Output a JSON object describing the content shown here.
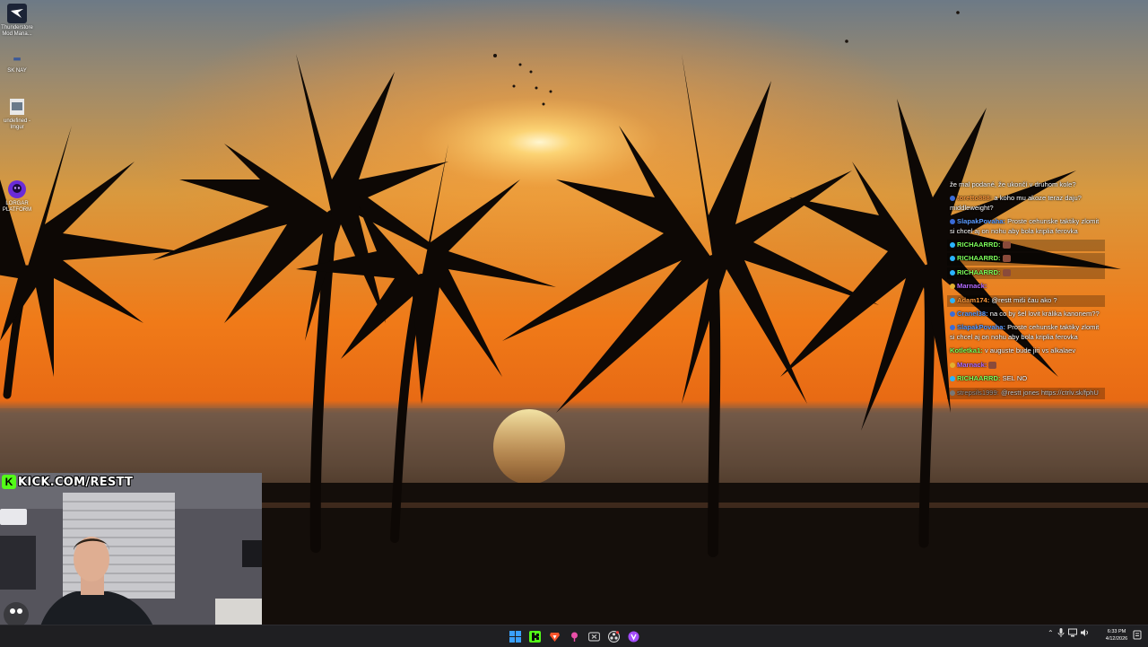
{
  "desktop": {
    "icons": [
      {
        "label": "Thunderstore Mod Mana...",
        "icon": "thunderstore-icon"
      },
      {
        "label": "SK NAY",
        "icon": "shortcut-icon"
      },
      {
        "label": "undefined - Imgur",
        "icon": "image-file-icon"
      },
      {
        "label": "LORGAR PLATFORM",
        "icon": "lorgar-icon"
      }
    ]
  },
  "chat": {
    "messages": [
      {
        "user": "",
        "text": "že mal podané, že ukončí v druhom kole?",
        "user_color": "#ffffff"
      },
      {
        "user": "toretto888:",
        "text": "a koho mu akoze teraz daju? middleweight?",
        "user_color": "#ff9a3c"
      },
      {
        "user": "SlapakPovaha:",
        "text": "Proste cehunske taktiky zlomit si chcel aj on nohu aby bola kriplia ferovka",
        "user_color": "#5b9bff"
      },
      {
        "user": "RICHAARRD:",
        "text": "",
        "user_color": "#7dff5a",
        "emote": true
      },
      {
        "user": "RICHAARRD:",
        "text": "",
        "user_color": "#7dff5a",
        "emote": true
      },
      {
        "user": "RICHAARRD:",
        "text": "",
        "user_color": "#7dff5a",
        "emote": true
      },
      {
        "user": "Marnack:",
        "text": "",
        "user_color": "#b46bff"
      },
      {
        "user": "Adam174:",
        "text": "@restt miši čau ako ?",
        "user_color": "#ff9a3c"
      },
      {
        "user": "Cranel38:",
        "text": "na co by šel lovit králika kanonem??",
        "user_color": "#5b9bff"
      },
      {
        "user": "SlapakPovaha:",
        "text": "Proste cehunske taktiky zlomit si chcel aj on nohu aby bola kriplia ferovka",
        "user_color": "#5b9bff"
      },
      {
        "user": "Kotletka1:",
        "text": "v auguste bude jiri vs alkalaev",
        "user_color": "#7dff5a"
      },
      {
        "user": "Marnack:",
        "text": "",
        "user_color": "#b46bff",
        "emote": true
      },
      {
        "user": "RICHAARRD:",
        "text": "SEL NO",
        "user_color": "#7dff5a"
      },
      {
        "user": "strepsils1999:",
        "text": "@restt jones https://ctrlv.sk/fphU",
        "user_color": "#9a9a9a"
      }
    ]
  },
  "overlay": {
    "kick_label": "KICK.COM/RESTT",
    "kick_logo": "K"
  },
  "taskbar": {
    "apps": [
      {
        "name": "windows-start-icon",
        "color": "#3aa0ff"
      },
      {
        "name": "kick-app-icon",
        "color": "#53fc18"
      },
      {
        "name": "brave-browser-icon",
        "color": "#fb542b"
      },
      {
        "name": "pink-pin-app-icon",
        "color": "#e94fa8"
      },
      {
        "name": "xbox-icon",
        "color": "#bbbbbb"
      },
      {
        "name": "obs-icon",
        "color": "#dddddd"
      },
      {
        "name": "purple-app-icon",
        "color": "#a44cff"
      }
    ],
    "clock_time": "6:33 PM",
    "clock_date": "4/12/2026"
  }
}
